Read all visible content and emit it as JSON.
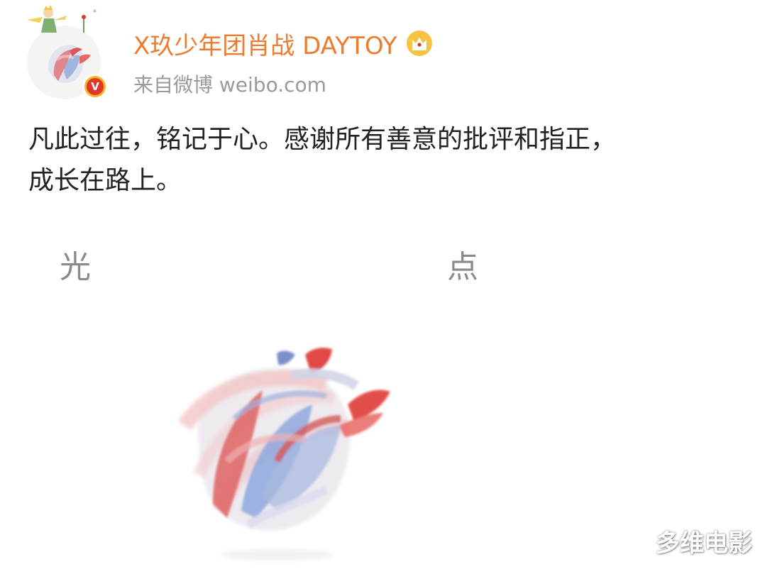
{
  "post": {
    "author": {
      "name": "X玖少年团肖战 DAYTOY",
      "avatar": "painted-heart-avatar",
      "verified_icon": "verified-v-badge-icon",
      "member_icon": "crown-icon"
    },
    "source": "来自微博 weibo.com",
    "text_lines": [
      "凡此过往，铭记于心。感谢所有善意的批评和指正，",
      "成长在路上。"
    ],
    "image": {
      "char_left": "光",
      "char_right": "点",
      "illustration": "painted-heart"
    }
  },
  "watermark": "多维电影",
  "colors": {
    "username": "#ee7c2e",
    "source_text": "#9a9a9a",
    "body_text": "#222222",
    "badge_red": "#e0372b",
    "badge_gold": "#f3b824"
  }
}
